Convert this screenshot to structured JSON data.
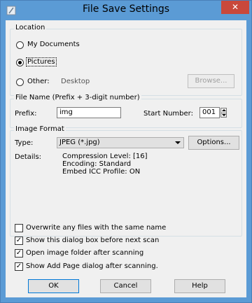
{
  "window": {
    "title": "File Save Settings",
    "close_glyph": "✕"
  },
  "location": {
    "group_title": "Location",
    "my_documents": "My Documents",
    "pictures": "Pictures",
    "other": "Other:",
    "other_path": "Desktop",
    "browse": "Browse...",
    "selected": "pictures"
  },
  "file_name": {
    "group_title": "File Name (Prefix + 3-digit number)",
    "prefix_label": "Prefix:",
    "prefix_value": "img",
    "start_number_label": "Start Number:",
    "start_number_value": "001"
  },
  "image_format": {
    "group_title": "Image Format",
    "type_label": "Type:",
    "type_value": "JPEG (*.jpg)",
    "options": "Options...",
    "details_label": "Details:",
    "details": [
      "Compression Level: [16]",
      "Encoding: Standard",
      "Embed ICC Profile: ON"
    ]
  },
  "checkboxes": [
    {
      "label": "Overwrite any files with the same name",
      "checked": false
    },
    {
      "label": "Show this dialog box before next scan",
      "checked": true
    },
    {
      "label": "Open image folder after scanning",
      "checked": true
    },
    {
      "label": "Show Add Page dialog after scanning.",
      "checked": true
    }
  ],
  "buttons": {
    "ok": "OK",
    "cancel": "Cancel",
    "help": "Help"
  },
  "check_glyph": "✓"
}
